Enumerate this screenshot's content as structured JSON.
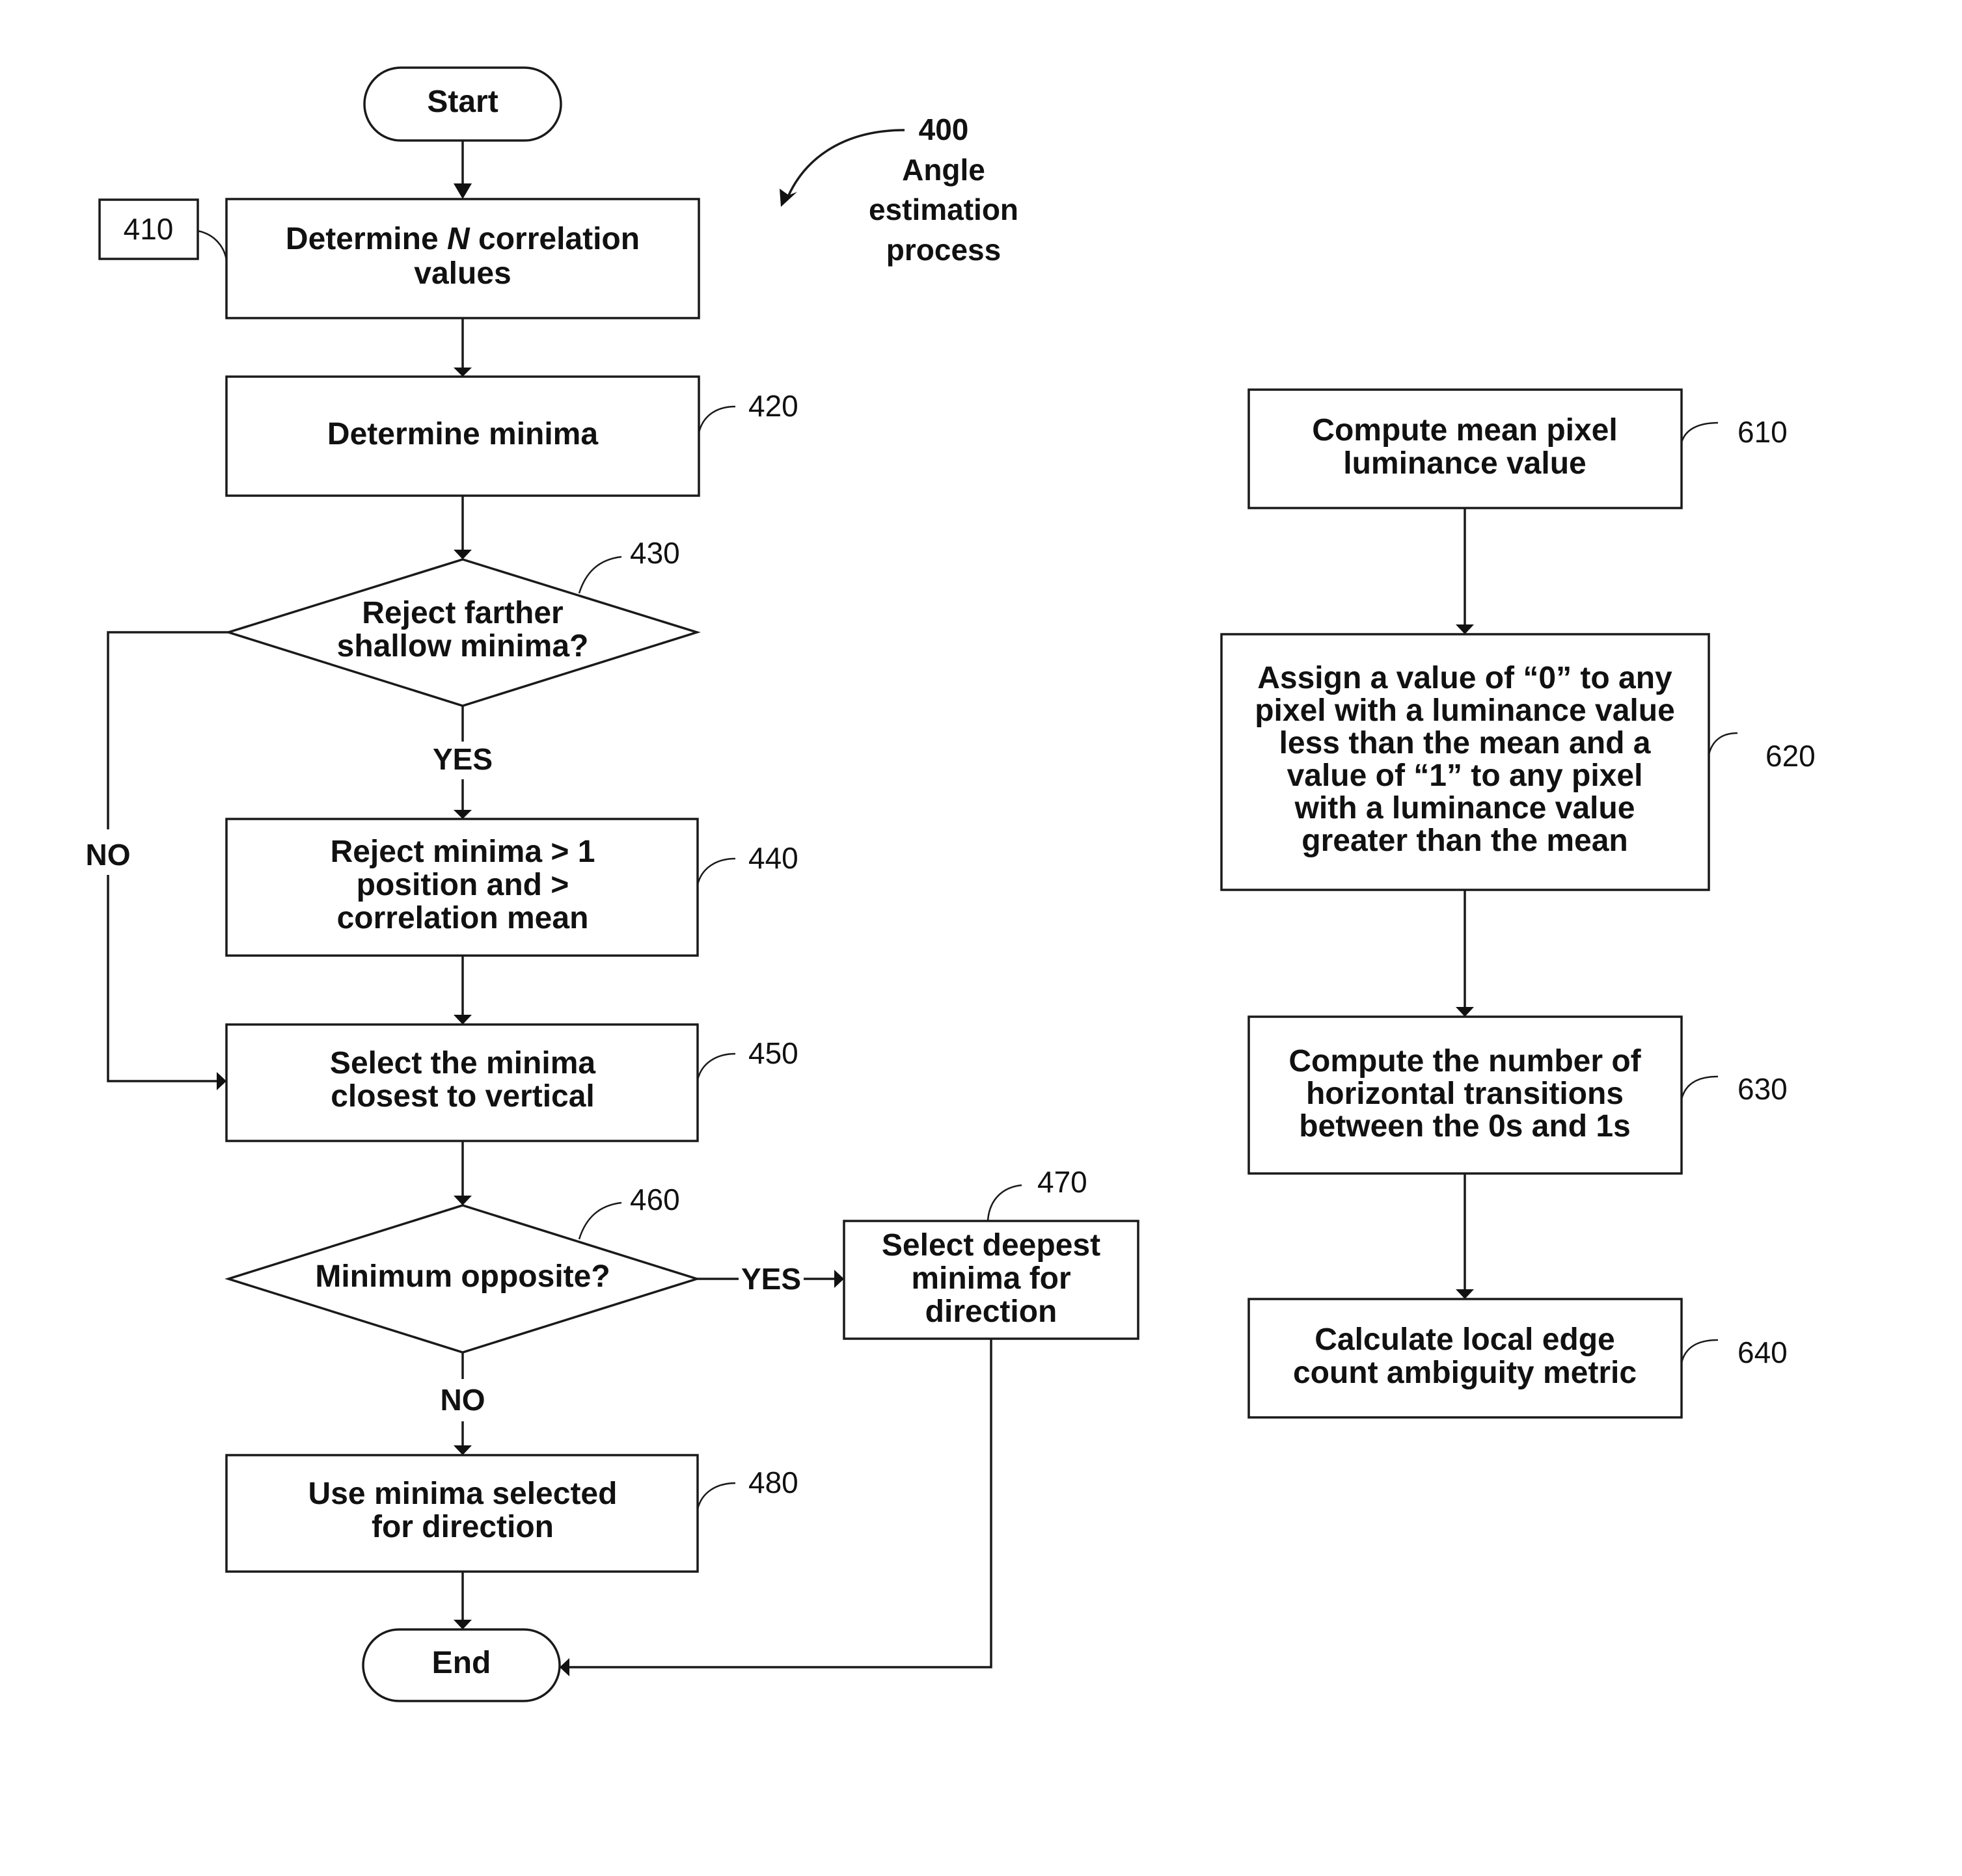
{
  "diagram": {
    "title_ref": "400",
    "title_lines": [
      "Angle",
      "estimation",
      "process"
    ],
    "left_flow": {
      "start": "Start",
      "end": "End",
      "n410": {
        "ref": "410",
        "lines": [
          "Determine N correlation",
          "values"
        ]
      },
      "n420": {
        "ref": "420",
        "lines": [
          "Determine minima"
        ]
      },
      "n430": {
        "ref": "430",
        "lines": [
          "Reject farther",
          "shallow minima?"
        ]
      },
      "n440": {
        "ref": "440",
        "lines": [
          "Reject minima > 1",
          "position and >",
          "correlation mean"
        ]
      },
      "n450": {
        "ref": "450",
        "lines": [
          "Select the minima",
          "closest to vertical"
        ]
      },
      "n460": {
        "ref": "460",
        "lines": [
          "Minimum opposite?"
        ]
      },
      "n470": {
        "ref": "470",
        "lines": [
          "Select deepest",
          "minima for",
          "direction"
        ]
      },
      "n480": {
        "ref": "480",
        "lines": [
          "Use minima selected",
          "for direction"
        ]
      },
      "labels": {
        "yes_430": "YES",
        "no_430": "NO",
        "yes_460": "YES",
        "no_460": "NO"
      }
    },
    "right_flow": {
      "n610": {
        "ref": "610",
        "lines": [
          "Compute mean pixel",
          "luminance value"
        ]
      },
      "n620": {
        "ref": "620",
        "lines": [
          "Assign a value of “0” to any",
          "pixel with a luminance value",
          "less than the mean and a",
          "value of “1” to any pixel",
          "with a luminance value",
          "greater than the mean"
        ]
      },
      "n630": {
        "ref": "630",
        "lines": [
          "Compute the number of",
          "horizontal transitions",
          "between the 0s and 1s"
        ]
      },
      "n640": {
        "ref": "640",
        "lines": [
          "Calculate local edge",
          "count ambiguity metric"
        ]
      }
    }
  }
}
